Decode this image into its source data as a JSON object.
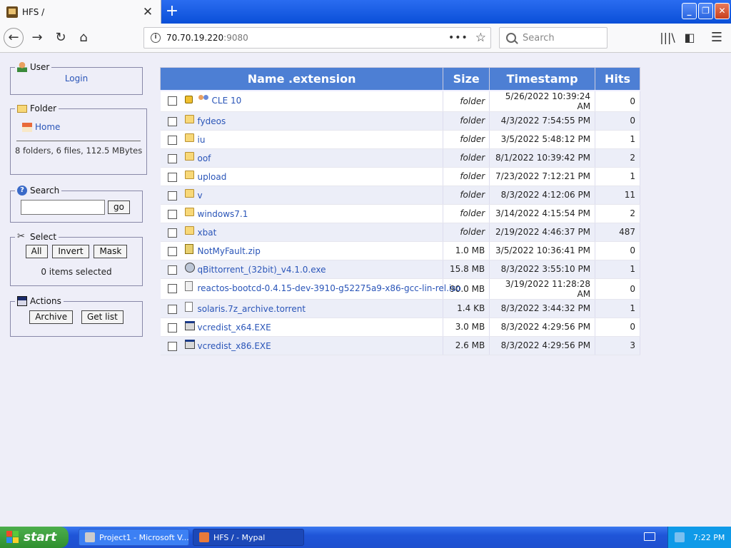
{
  "browser": {
    "tab_title": "HFS /",
    "url_host": "70.70.19.220",
    "url_port": ":9080",
    "search_placeholder": "Search"
  },
  "sidebar": {
    "user": {
      "legend": "User",
      "login_link": "Login"
    },
    "folder": {
      "legend": "Folder",
      "home_link": "Home",
      "summary": "8 folders, 6 files, 112.5 MBytes"
    },
    "search": {
      "legend": "Search",
      "go_label": "go"
    },
    "select": {
      "legend": "Select",
      "all_label": "All",
      "invert_label": "Invert",
      "mask_label": "Mask",
      "status": "0 items selected"
    },
    "actions": {
      "legend": "Actions",
      "archive_label": "Archive",
      "getlist_label": "Get list"
    }
  },
  "table": {
    "headers": {
      "name": "Name .extension",
      "size": "Size",
      "timestamp": "Timestamp",
      "hits": "Hits"
    },
    "rows": [
      {
        "name": "CLE 10",
        "icon": "locked-folder-users-icon",
        "size": "folder",
        "timestamp": "5/26/2022 10:39:24 AM",
        "hits": "0"
      },
      {
        "name": "fydeos",
        "icon": "folder-icon",
        "size": "folder",
        "timestamp": "4/3/2022 7:54:55 PM",
        "hits": "0"
      },
      {
        "name": "iu",
        "icon": "folder-icon",
        "size": "folder",
        "timestamp": "3/5/2022 5:48:12 PM",
        "hits": "1"
      },
      {
        "name": "oof",
        "icon": "folder-icon",
        "size": "folder",
        "timestamp": "8/1/2022 10:39:42 PM",
        "hits": "2"
      },
      {
        "name": "upload",
        "icon": "folder-icon",
        "size": "folder",
        "timestamp": "7/23/2022 7:12:21 PM",
        "hits": "1"
      },
      {
        "name": "v",
        "icon": "folder-icon",
        "size": "folder",
        "timestamp": "8/3/2022 4:12:06 PM",
        "hits": "11"
      },
      {
        "name": "windows7.1",
        "icon": "folder-icon",
        "size": "folder",
        "timestamp": "3/14/2022 4:15:54 PM",
        "hits": "2"
      },
      {
        "name": "xbat",
        "icon": "folder-icon",
        "size": "folder",
        "timestamp": "2/19/2022 4:46:37 PM",
        "hits": "487"
      },
      {
        "name": "NotMyFault.zip",
        "icon": "zip-icon",
        "size": "1.0 MB",
        "timestamp": "3/5/2022 10:36:41 PM",
        "hits": "0"
      },
      {
        "name": "qBittorrent_(32bit)_v4.1.0.exe",
        "icon": "qbittorrent-icon",
        "size": "15.8 MB",
        "timestamp": "8/3/2022 3:55:10 PM",
        "hits": "1"
      },
      {
        "name": "reactos-bootcd-0.4.15-dev-3910-g52275a9-x86-gcc-lin-rel.iso",
        "icon": "iso-icon",
        "size": "90.0 MB",
        "timestamp": "3/19/2022 11:28:28 AM",
        "hits": "0"
      },
      {
        "name": "solaris.7z_archive.torrent",
        "icon": "file-icon",
        "size": "1.4 KB",
        "timestamp": "8/3/2022 3:44:32 PM",
        "hits": "1"
      },
      {
        "name": "vcredist_x64.EXE",
        "icon": "exe-icon",
        "size": "3.0 MB",
        "timestamp": "8/3/2022 4:29:56 PM",
        "hits": "0"
      },
      {
        "name": "vcredist_x86.EXE",
        "icon": "exe-icon",
        "size": "2.6 MB",
        "timestamp": "8/3/2022 4:29:56 PM",
        "hits": "3"
      }
    ]
  },
  "taskbar": {
    "start_label": "start",
    "tasks": [
      {
        "label": "Project1 - Microsoft V..."
      },
      {
        "label": "HFS / - Mypal"
      }
    ],
    "clock": "7:22 PM"
  },
  "colors": {
    "header_blue": "#4d7fd4",
    "link_blue": "#2a55b8",
    "page_bg": "#eeeef8"
  }
}
